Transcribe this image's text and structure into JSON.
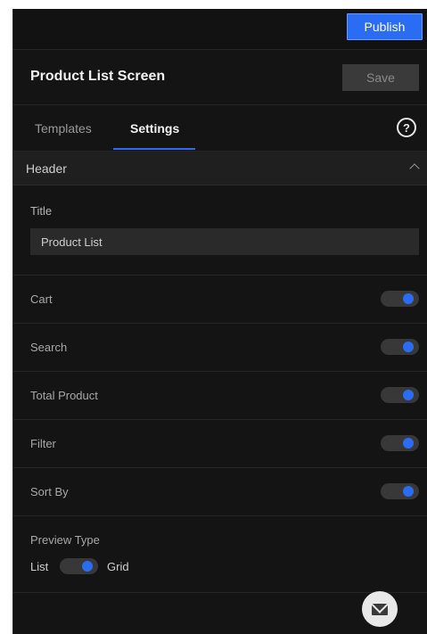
{
  "topbar": {
    "publish_label": "Publish"
  },
  "screen": {
    "title": "Product List Screen",
    "save_label": "Save"
  },
  "tabs": [
    {
      "label": "Templates",
      "active": false
    },
    {
      "label": "Settings",
      "active": true
    }
  ],
  "help": {
    "icon": "help-circle-icon",
    "glyph": "?"
  },
  "section": {
    "title": "Header",
    "expanded": true
  },
  "title_field": {
    "label": "Title",
    "value": "Product List"
  },
  "toggles": [
    {
      "label": "Cart",
      "on": true
    },
    {
      "label": "Search",
      "on": true
    },
    {
      "label": "Total Product",
      "on": true
    },
    {
      "label": "Filter",
      "on": true
    },
    {
      "label": "Sort By",
      "on": true
    }
  ],
  "preview": {
    "label": "Preview Type",
    "left_option": "List",
    "right_option": "Grid",
    "selected": "Grid"
  },
  "colors": {
    "accent": "#2a6df4",
    "panel_bg": "#141414",
    "section_bg": "#1f1f1f"
  },
  "chat": {
    "icon": "mail-icon"
  }
}
